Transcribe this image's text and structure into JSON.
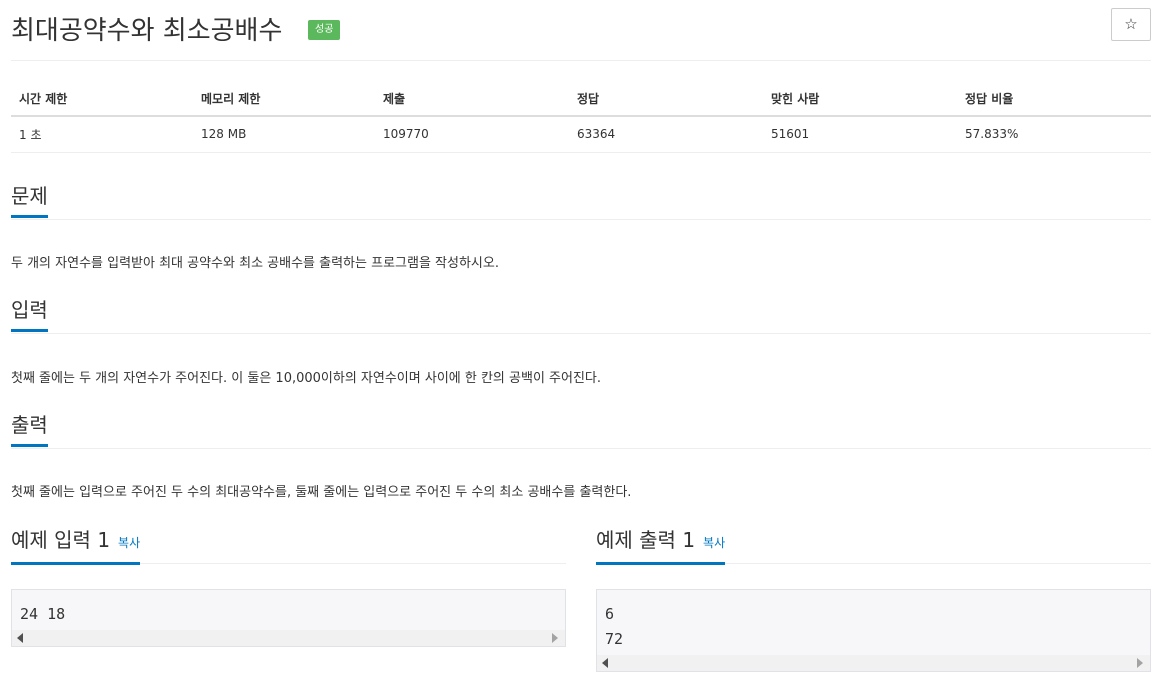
{
  "problem": {
    "title": "최대공약수와 최소공배수",
    "status_badge": "성공",
    "star_icon": "☆"
  },
  "info_table": {
    "headers": [
      "시간 제한",
      "메모리 제한",
      "제출",
      "정답",
      "맞힌 사람",
      "정답 비율"
    ],
    "values": [
      "1 초",
      "128 MB",
      "109770",
      "63364",
      "51601",
      "57.833%"
    ]
  },
  "sections": {
    "description": {
      "heading": "문제",
      "text": "두 개의 자연수를 입력받아 최대 공약수와 최소 공배수를 출력하는 프로그램을 작성하시오."
    },
    "input": {
      "heading": "입력",
      "text": "첫째 줄에는 두 개의 자연수가 주어진다. 이 둘은 10,000이하의 자연수이며 사이에 한 칸의 공백이 주어진다."
    },
    "output": {
      "heading": "출력",
      "text": "첫째 줄에는 입력으로 주어진 두 수의 최대공약수를, 둘째 줄에는 입력으로 주어진 두 수의 최소 공배수를 출력한다."
    }
  },
  "examples": {
    "sample_input": {
      "heading": "예제 입력 1",
      "copy_label": "복사",
      "lines": [
        "24 18"
      ]
    },
    "sample_output": {
      "heading": "예제 출력 1",
      "copy_label": "복사",
      "lines": [
        "6",
        "72"
      ]
    }
  },
  "colors": {
    "accent": "#0076c0",
    "success_badge": "#5cb85c",
    "pre_background": "#f7f7f9"
  }
}
